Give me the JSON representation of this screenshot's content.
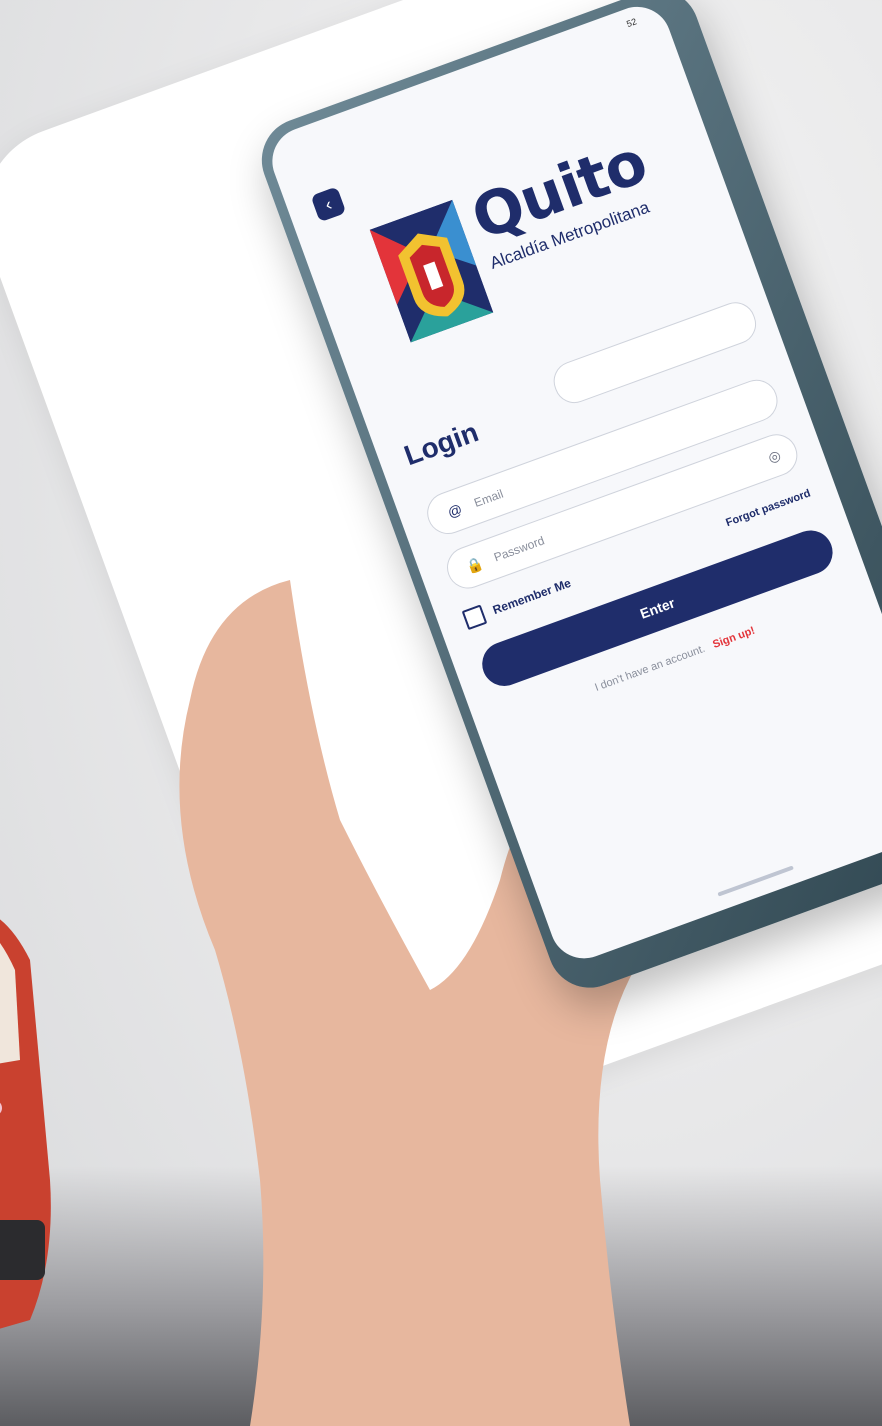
{
  "status": {
    "time": "52"
  },
  "nav": {
    "back_icon": "chevron-left-icon"
  },
  "brand": {
    "title": "Quito",
    "subtitle": "Alcaldía Metropolitana",
    "logo_icon": "quito-coat-of-arms-icon"
  },
  "login": {
    "title": "Login",
    "email_placeholder": "Email",
    "password_placeholder": "Password",
    "remember_label": "Remember Me",
    "forgot_label": "Forgot password",
    "enter_label": "Enter",
    "no_account_text": "I don't have an account.",
    "signup_label": "Sign up!"
  },
  "colors": {
    "primary": "#1f2d6b",
    "accent": "#e3343a",
    "background": "#f7f8fb"
  }
}
